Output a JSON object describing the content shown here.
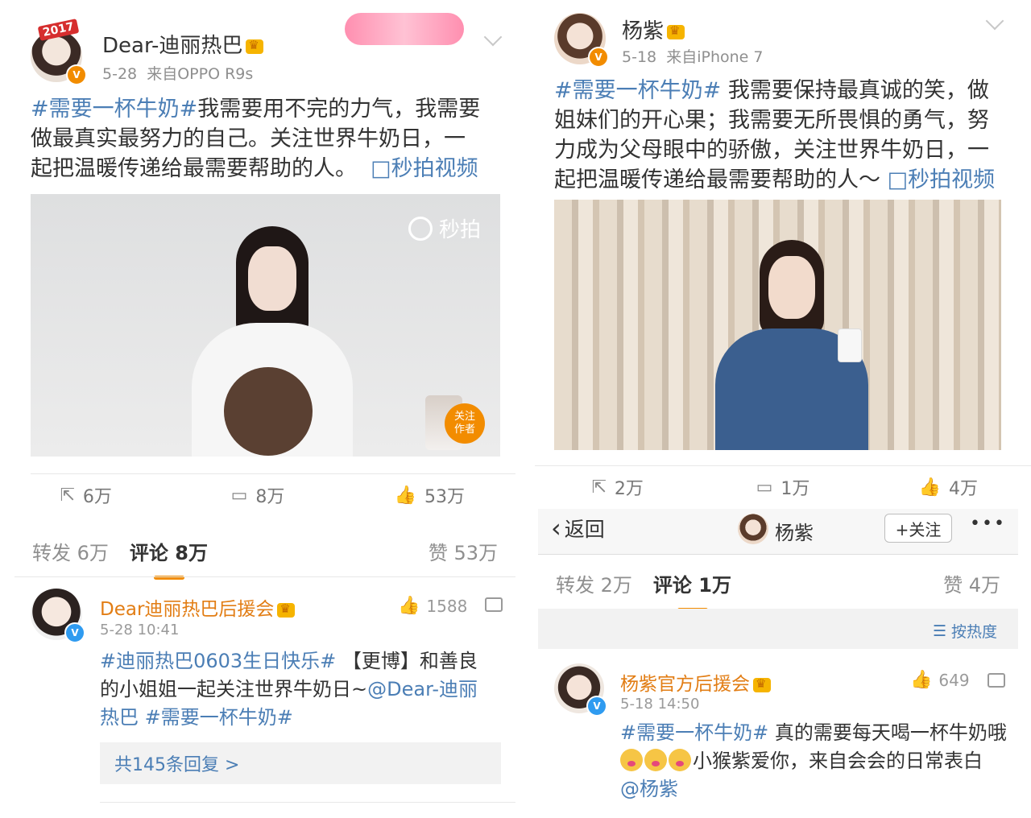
{
  "left": {
    "post": {
      "username": "Dear-迪丽热巴",
      "time": "5-28",
      "source": "来自OPPO R9s",
      "year_badge": "2017",
      "text_topic": "#需要一杯牛奶#",
      "text_line1": "我需要用不完的力气，我需要",
      "text_line2": "做最真实最努力的自己。关注世界牛奶日，一",
      "text_line3": "起把温暖传递给最需要帮助的人。",
      "video_link": "□秒拍视频",
      "video_watermark": "秒拍",
      "video_follow_line1": "关注",
      "video_follow_line2": "作者",
      "repost_count": "6万",
      "comment_count": "8万",
      "like_count": "53万"
    },
    "tabs": {
      "repost": "转发 6万",
      "comment": "评论 8万",
      "like": "赞 53万"
    },
    "comment": {
      "name": "Dear迪丽热巴后援会",
      "time": "5-28 10:41",
      "likes": "1588",
      "topic1": "#迪丽热巴0603生日快乐#",
      "line1_rest": " 【更博】和善良",
      "line2": "的小姐姐一起关注世界牛奶日~",
      "mention": "@Dear-迪丽",
      "line3_mention": "热巴",
      "topic2": " #需要一杯牛奶#",
      "replies": "共145条回复 >"
    }
  },
  "right": {
    "post": {
      "username": "杨紫",
      "time": "5-18",
      "source": "来自iPhone 7",
      "text_topic": "#需要一杯牛奶#",
      "text_line1": " 我需要保持最真诚的笑，做",
      "text_line2": "姐妹们的开心果；我需要无所畏惧的勇气，努",
      "text_line3": "力成为父母眼中的骄傲，关注世界牛奶日，一",
      "text_line4": "起把温暖传递给最需要帮助的人～",
      "video_link": "□秒拍视频",
      "repost_count": "2万",
      "comment_count": "1万",
      "like_count": "4万"
    },
    "nav": {
      "back": "返回",
      "title": "杨紫",
      "follow": "+关注",
      "more": "•••"
    },
    "tabs": {
      "repost": "转发 2万",
      "comment": "评论 1万",
      "like": "赞 4万"
    },
    "sort": "按热度",
    "comment": {
      "name": "杨紫官方后援会",
      "time": "5-18 14:50",
      "likes": "649",
      "topic": "#需要一杯牛奶#",
      "line1_rest": " 真的需要每天喝一杯牛奶哦",
      "line2_rest": "小猴紫爱你，来自会会的日常表白",
      "mention": "@杨紫"
    }
  },
  "icons": {
    "repost": "share-icon",
    "comment": "comment-icon",
    "like": "thumbs-up-icon",
    "verified": "verified-badge-icon"
  },
  "colors": {
    "link": "#4b7eb5",
    "accent": "#f28c00",
    "fan_club_name": "#e27d14"
  }
}
